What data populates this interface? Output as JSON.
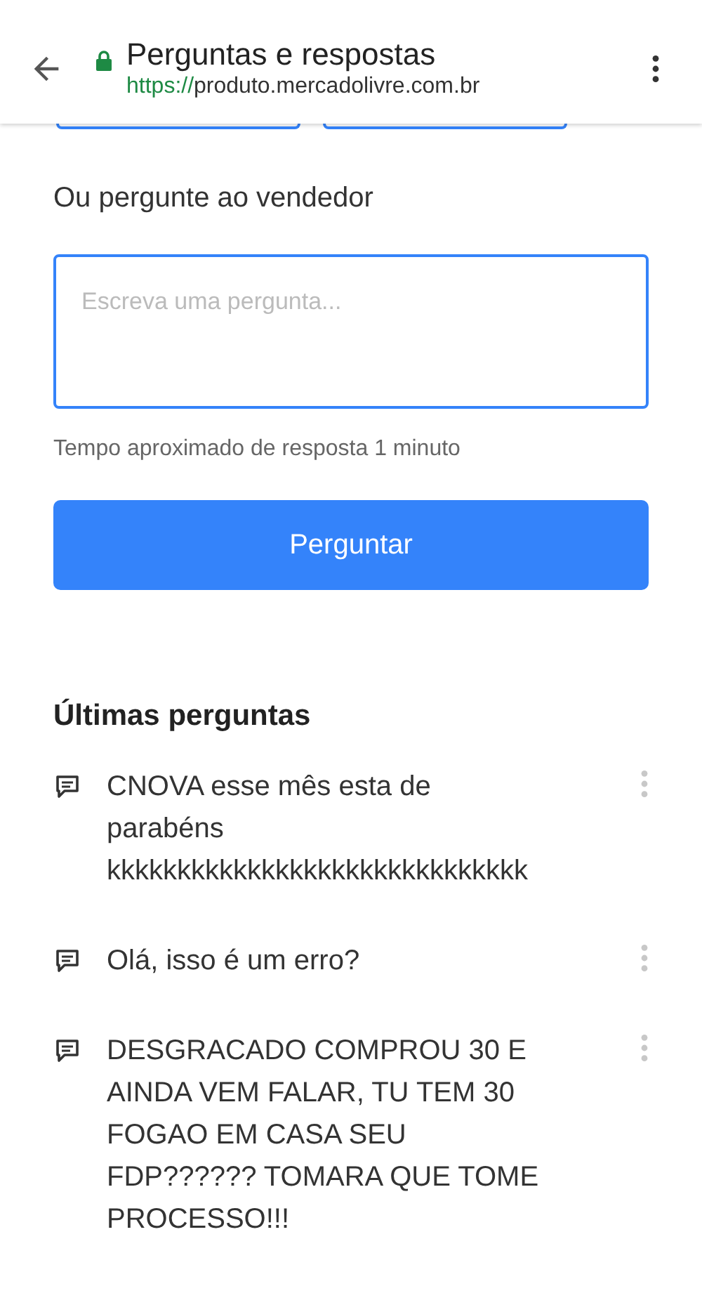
{
  "toolbar": {
    "title": "Perguntas e respostas",
    "url_scheme": "https://",
    "url_host": "produto.mercadolivre.com.br"
  },
  "ask": {
    "heading": "Ou pergunte ao vendedor",
    "placeholder": "Escreva uma pergunta...",
    "hint": "Tempo aproximado de resposta 1 minuto",
    "button": "Perguntar"
  },
  "questions": {
    "heading": "Últimas perguntas",
    "items": [
      {
        "text": "CNOVA esse mês esta de parabéns kkkkkkkkkkkkkkkkkkkkkkkkkkkkkk"
      },
      {
        "text": "Olá, isso é um erro?"
      },
      {
        "text": "DESGRACADO COMPROU 30 E AINDA VEM FALAR, TU TEM 30 FOGAO EM CASA SEU FDP?????? TOMARA QUE TOME PROCESSO!!!"
      }
    ]
  }
}
